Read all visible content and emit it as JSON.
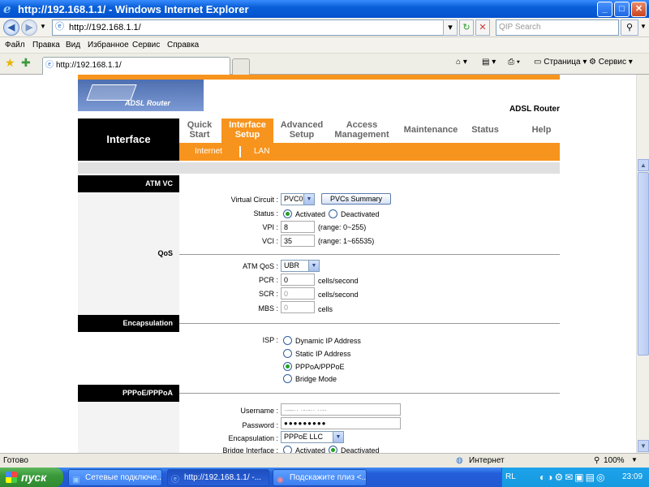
{
  "window": {
    "title": "http://192.168.1.1/ - Windows Internet Explorer",
    "min": "_",
    "max": "□",
    "close": "✕"
  },
  "address": {
    "url": "http://192.168.1.1/",
    "search_placeholder": "QIP Search"
  },
  "menu": [
    "Файл",
    "Правка",
    "Вид",
    "Избранное",
    "Сервис",
    "Справка"
  ],
  "tab": {
    "title": "http://192.168.1.1/"
  },
  "toolbar": {
    "page_label": "Страница",
    "tools_label": "Сервис"
  },
  "router": {
    "logo_text": "ADSL Router",
    "model_label": "ADSL Router",
    "section_title": "Interface",
    "nav": [
      {
        "l1": "Quick",
        "l2": "Start"
      },
      {
        "l1": "Interface",
        "l2": "Setup"
      },
      {
        "l1": "Advanced",
        "l2": "Setup"
      },
      {
        "l1": "Access",
        "l2": "Management"
      },
      {
        "l1": "Maintenance",
        "l2": ""
      },
      {
        "l1": "Status",
        "l2": ""
      },
      {
        "l1": "Help",
        "l2": ""
      }
    ],
    "subnav": [
      "Internet",
      "LAN"
    ],
    "sections": {
      "atm": "ATM VC",
      "qos": "QoS",
      "encap": "Encapsulation",
      "pppoe": "PPPoE/PPPoA"
    },
    "atm": {
      "vc_label": "Virtual Circuit :",
      "vc_value": "PVC0",
      "pvc_button": "PVCs Summary",
      "status_label": "Status :",
      "status_activated": "Activated",
      "status_deactivated": "Deactivated",
      "vpi_label": "VPI :",
      "vpi_value": "8",
      "vpi_hint": "(range: 0~255)",
      "vci_label": "VCI :",
      "vci_value": "35",
      "vci_hint": "(range: 1~65535)"
    },
    "qos": {
      "atmqos_label": "ATM QoS :",
      "atmqos_value": "UBR",
      "pcr_label": "PCR :",
      "pcr_value": "0",
      "pcr_unit": "cells/second",
      "scr_label": "SCR :",
      "scr_value": "0",
      "scr_unit": "cells/second",
      "mbs_label": "MBS :",
      "mbs_value": "0",
      "mbs_unit": "cells"
    },
    "encap": {
      "isp_label": "ISP :",
      "options": [
        "Dynamic IP Address",
        "Static IP Address",
        "PPPoA/PPPoE",
        "Bridge Mode"
      ],
      "selected": "PPPoA/PPPoE"
    },
    "pppoe": {
      "username_label": "Username :",
      "username_value": "·—·· ·-·-·· ··-·",
      "password_label": "Password :",
      "password_value": "●●●●●●●●●",
      "encap_label": "Encapsulation :",
      "encap_value": "PPPoE LLC",
      "bridge_label": "Bridge Interface :",
      "bridge_activated": "Activated",
      "bridge_deactivated": "Deactivated"
    }
  },
  "statusbar": {
    "left": "Готово",
    "zone": "Интернет",
    "zoom": "100%"
  },
  "taskbar": {
    "start": "пуск",
    "tasks": [
      "Сетевые подключе...",
      "http://192.168.1.1/ -...",
      "Подскажите плиз <..."
    ],
    "lang": "RL",
    "clock": "23:09"
  }
}
